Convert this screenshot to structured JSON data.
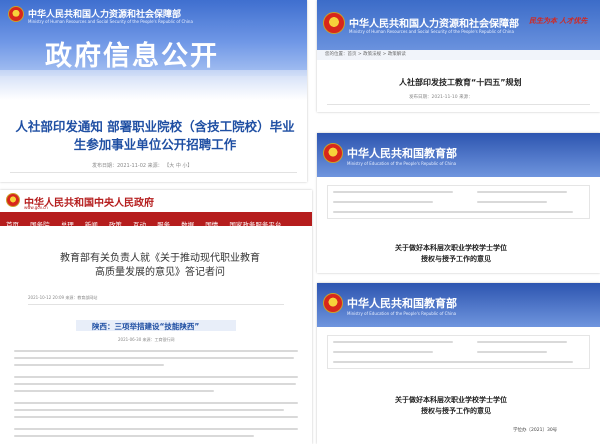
{
  "panel_a": {
    "cn_title": "中华人民共和国人力资源和社会保障部",
    "en_title": "Ministry of Human Resources and Social Security of the People's Republic of China",
    "banner_text": "政府信息公开",
    "headline": "人社部印发通知 部署职业院校（含技工院校）毕业生参加事业单位公开招聘工作",
    "meta": "发布日期：2021-11-02  来源：  【大 中 小】"
  },
  "panel_b": {
    "cn_title": "中华人民共和国人力资源和社会保障部",
    "en_title": "Ministry of Human Resources and Social Security of the People's Republic of China",
    "slogan": "民生为本 人才优先",
    "breadcrumb": "您的位置：首页 > 政策法规 > 政策解读",
    "headline": "人社部印发技工教育“十四五”规划",
    "meta": "发布日期：2021-11-10  来源："
  },
  "panel_c": {
    "cn_title": "中华人民共和国中央人民政府",
    "url": "www.gov.cn",
    "nav": [
      "首页",
      "国务院",
      "总理",
      "新闻",
      "政策",
      "互动",
      "服务",
      "数据",
      "国情",
      "国家政务服务平台"
    ],
    "headline": "教育部有关负责人就《关于推动现代职业教育高质量发展的意见》答记者问",
    "meta": "2021-10-12 20:09  来源：教育部网站",
    "subheadline": "陕西：三项举措建设“技能陕西”",
    "sub_meta": "2021-06-30  来源：工商银行网"
  },
  "panel_d": {
    "cn_title": "中华人民共和国教育部",
    "en_title": "Ministry of Education of the People's Republic of China",
    "doc_title_line1": "关于做好本科层次职业学校学士学位",
    "doc_title_line2": "授权与授予工作的意见"
  },
  "panel_e": {
    "cn_title": "中华人民共和国教育部",
    "en_title": "Ministry of Education of the People's Republic of China",
    "doc_title_line1": "关于做好本科层次职业学校学士学位",
    "doc_title_line2": "授权与授予工作的意见",
    "doc_number": "学位办〔2021〕30号"
  },
  "colors": {
    "mohrss_blue": "#3f6fcf",
    "gov_red": "#b51d1d",
    "moe_blue": "#2d55b0",
    "headline_blue": "#1f4fa3"
  }
}
